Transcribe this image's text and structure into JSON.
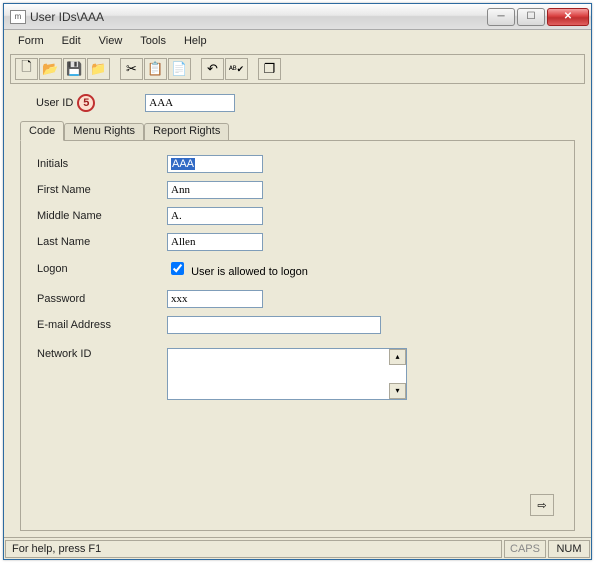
{
  "window": {
    "title": "User IDs\\AAA",
    "icon_label": "m"
  },
  "menu": {
    "items": [
      "Form",
      "Edit",
      "View",
      "Tools",
      "Help"
    ]
  },
  "toolbar": {
    "icons": [
      "new-icon",
      "open-icon",
      "save-icon",
      "folder-up-icon",
      "cut-icon",
      "copy-icon",
      "paste-icon",
      "undo-icon",
      "spellcheck-icon",
      "cascade-icon"
    ]
  },
  "header": {
    "user_id_label": "User ID",
    "badge": "5",
    "user_id_value": "AAA"
  },
  "tabs": [
    "Code",
    "Menu Rights",
    "Report Rights"
  ],
  "form": {
    "initials_label": "Initials",
    "initials_value": "AAA",
    "first_name_label": "First Name",
    "first_name_value": "Ann",
    "middle_name_label": "Middle Name",
    "middle_name_value": "A.",
    "last_name_label": "Last Name",
    "last_name_value": "Allen",
    "logon_label": "Logon",
    "logon_check_label": "User is allowed to logon",
    "logon_checked": true,
    "password_label": "Password",
    "password_value": "xxx",
    "email_label": "E-mail Address",
    "email_value": "",
    "network_id_label": "Network ID",
    "network_id_value": ""
  },
  "arrow_button": "⇨",
  "statusbar": {
    "help": "For help, press F1",
    "caps": "CAPS",
    "num": "NUM"
  }
}
